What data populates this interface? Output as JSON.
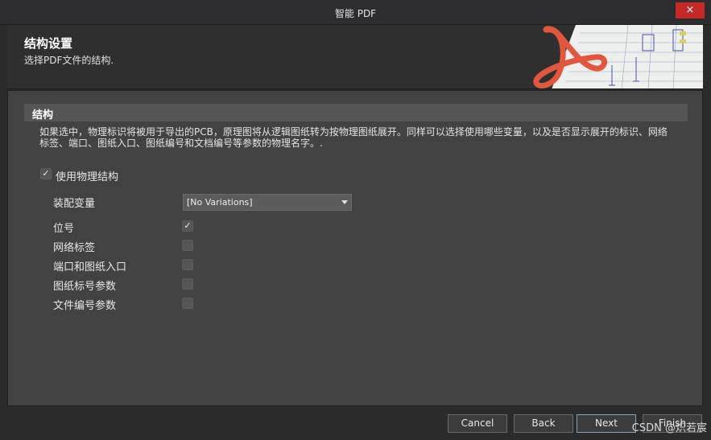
{
  "window": {
    "title": "智能 PDF",
    "close_icon": "×"
  },
  "header": {
    "title": "结构设置",
    "subtitle": "选择PDF文件的结构."
  },
  "section": {
    "title": "结构",
    "description": "如果选中，物理标识将被用于导出的PCB，原理图将从逻辑图纸转为按物理图纸展开。同样可以选择使用哪些变量，以及是否显示展开的标识、网络标签、端口、图纸入口、图纸编号和文档编号等参数的物理名字。."
  },
  "use_physical": {
    "label": "使用物理结构",
    "checked": true
  },
  "variant": {
    "label": "装配变量",
    "value": "[No Variations]"
  },
  "options": [
    {
      "label": "位号",
      "checked": true
    },
    {
      "label": "网络标签",
      "checked": false
    },
    {
      "label": "端口和图纸入口",
      "checked": false
    },
    {
      "label": "图纸标号参数",
      "checked": false
    },
    {
      "label": "文件编号参数",
      "checked": false
    }
  ],
  "footer": {
    "cancel": "Cancel",
    "back": "Back",
    "next": "Next",
    "finish": "Finish"
  },
  "watermark": "CSDN @炽若宸",
  "colors": {
    "accent_red": "#e0563f",
    "close_red": "#c62828",
    "panel": "#424242"
  }
}
